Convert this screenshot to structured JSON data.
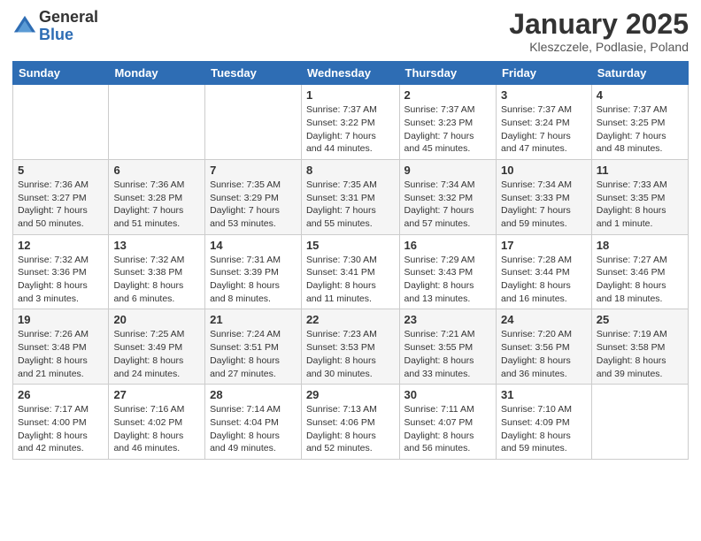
{
  "logo": {
    "general": "General",
    "blue": "Blue"
  },
  "header": {
    "title": "January 2025",
    "subtitle": "Kleszczele, Podlasie, Poland"
  },
  "weekdays": [
    "Sunday",
    "Monday",
    "Tuesday",
    "Wednesday",
    "Thursday",
    "Friday",
    "Saturday"
  ],
  "weeks": [
    [
      {
        "day": "",
        "info": ""
      },
      {
        "day": "",
        "info": ""
      },
      {
        "day": "",
        "info": ""
      },
      {
        "day": "1",
        "info": "Sunrise: 7:37 AM\nSunset: 3:22 PM\nDaylight: 7 hours\nand 44 minutes."
      },
      {
        "day": "2",
        "info": "Sunrise: 7:37 AM\nSunset: 3:23 PM\nDaylight: 7 hours\nand 45 minutes."
      },
      {
        "day": "3",
        "info": "Sunrise: 7:37 AM\nSunset: 3:24 PM\nDaylight: 7 hours\nand 47 minutes."
      },
      {
        "day": "4",
        "info": "Sunrise: 7:37 AM\nSunset: 3:25 PM\nDaylight: 7 hours\nand 48 minutes."
      }
    ],
    [
      {
        "day": "5",
        "info": "Sunrise: 7:36 AM\nSunset: 3:27 PM\nDaylight: 7 hours\nand 50 minutes."
      },
      {
        "day": "6",
        "info": "Sunrise: 7:36 AM\nSunset: 3:28 PM\nDaylight: 7 hours\nand 51 minutes."
      },
      {
        "day": "7",
        "info": "Sunrise: 7:35 AM\nSunset: 3:29 PM\nDaylight: 7 hours\nand 53 minutes."
      },
      {
        "day": "8",
        "info": "Sunrise: 7:35 AM\nSunset: 3:31 PM\nDaylight: 7 hours\nand 55 minutes."
      },
      {
        "day": "9",
        "info": "Sunrise: 7:34 AM\nSunset: 3:32 PM\nDaylight: 7 hours\nand 57 minutes."
      },
      {
        "day": "10",
        "info": "Sunrise: 7:34 AM\nSunset: 3:33 PM\nDaylight: 7 hours\nand 59 minutes."
      },
      {
        "day": "11",
        "info": "Sunrise: 7:33 AM\nSunset: 3:35 PM\nDaylight: 8 hours\nand 1 minute."
      }
    ],
    [
      {
        "day": "12",
        "info": "Sunrise: 7:32 AM\nSunset: 3:36 PM\nDaylight: 8 hours\nand 3 minutes."
      },
      {
        "day": "13",
        "info": "Sunrise: 7:32 AM\nSunset: 3:38 PM\nDaylight: 8 hours\nand 6 minutes."
      },
      {
        "day": "14",
        "info": "Sunrise: 7:31 AM\nSunset: 3:39 PM\nDaylight: 8 hours\nand 8 minutes."
      },
      {
        "day": "15",
        "info": "Sunrise: 7:30 AM\nSunset: 3:41 PM\nDaylight: 8 hours\nand 11 minutes."
      },
      {
        "day": "16",
        "info": "Sunrise: 7:29 AM\nSunset: 3:43 PM\nDaylight: 8 hours\nand 13 minutes."
      },
      {
        "day": "17",
        "info": "Sunrise: 7:28 AM\nSunset: 3:44 PM\nDaylight: 8 hours\nand 16 minutes."
      },
      {
        "day": "18",
        "info": "Sunrise: 7:27 AM\nSunset: 3:46 PM\nDaylight: 8 hours\nand 18 minutes."
      }
    ],
    [
      {
        "day": "19",
        "info": "Sunrise: 7:26 AM\nSunset: 3:48 PM\nDaylight: 8 hours\nand 21 minutes."
      },
      {
        "day": "20",
        "info": "Sunrise: 7:25 AM\nSunset: 3:49 PM\nDaylight: 8 hours\nand 24 minutes."
      },
      {
        "day": "21",
        "info": "Sunrise: 7:24 AM\nSunset: 3:51 PM\nDaylight: 8 hours\nand 27 minutes."
      },
      {
        "day": "22",
        "info": "Sunrise: 7:23 AM\nSunset: 3:53 PM\nDaylight: 8 hours\nand 30 minutes."
      },
      {
        "day": "23",
        "info": "Sunrise: 7:21 AM\nSunset: 3:55 PM\nDaylight: 8 hours\nand 33 minutes."
      },
      {
        "day": "24",
        "info": "Sunrise: 7:20 AM\nSunset: 3:56 PM\nDaylight: 8 hours\nand 36 minutes."
      },
      {
        "day": "25",
        "info": "Sunrise: 7:19 AM\nSunset: 3:58 PM\nDaylight: 8 hours\nand 39 minutes."
      }
    ],
    [
      {
        "day": "26",
        "info": "Sunrise: 7:17 AM\nSunset: 4:00 PM\nDaylight: 8 hours\nand 42 minutes."
      },
      {
        "day": "27",
        "info": "Sunrise: 7:16 AM\nSunset: 4:02 PM\nDaylight: 8 hours\nand 46 minutes."
      },
      {
        "day": "28",
        "info": "Sunrise: 7:14 AM\nSunset: 4:04 PM\nDaylight: 8 hours\nand 49 minutes."
      },
      {
        "day": "29",
        "info": "Sunrise: 7:13 AM\nSunset: 4:06 PM\nDaylight: 8 hours\nand 52 minutes."
      },
      {
        "day": "30",
        "info": "Sunrise: 7:11 AM\nSunset: 4:07 PM\nDaylight: 8 hours\nand 56 minutes."
      },
      {
        "day": "31",
        "info": "Sunrise: 7:10 AM\nSunset: 4:09 PM\nDaylight: 8 hours\nand 59 minutes."
      },
      {
        "day": "",
        "info": ""
      }
    ]
  ]
}
